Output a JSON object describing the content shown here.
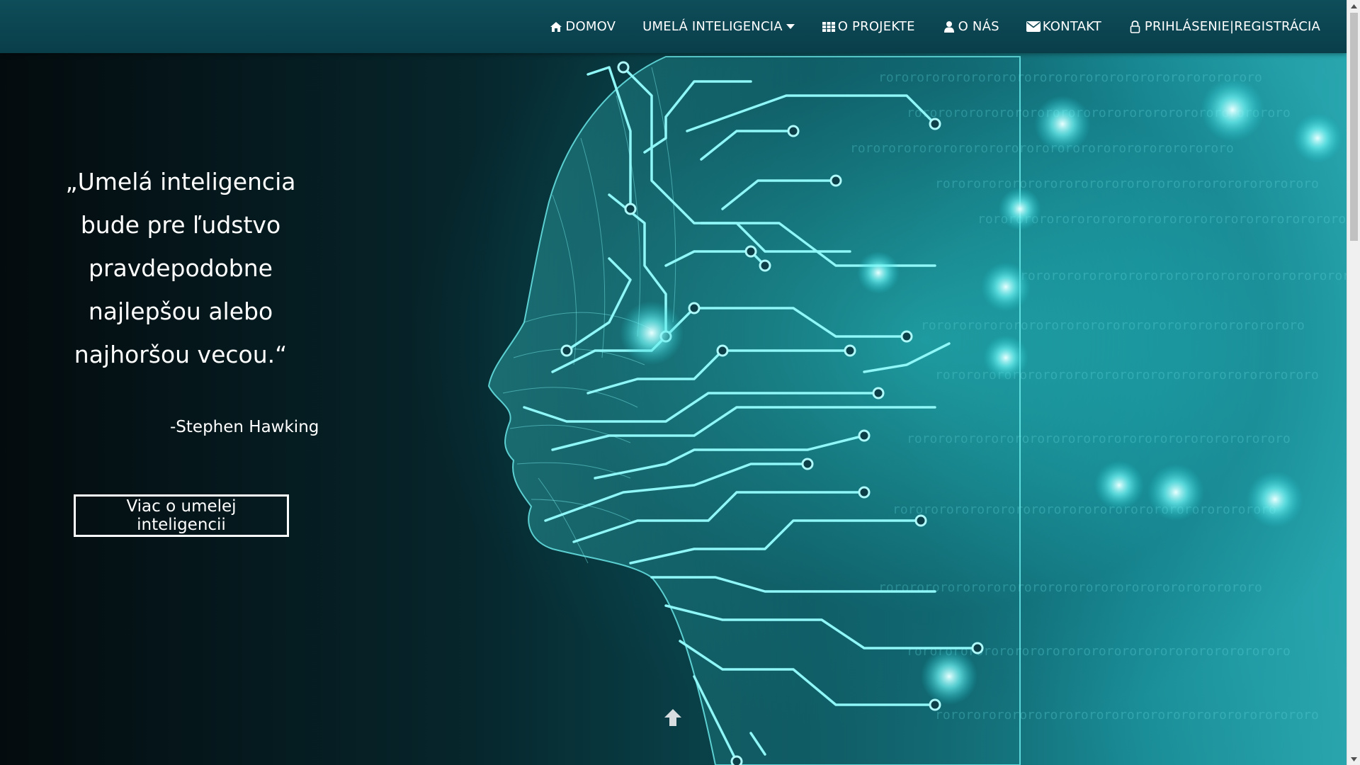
{
  "nav": {
    "items": [
      {
        "label": "DOMOV",
        "icon": "home-icon"
      },
      {
        "label": "UMELÁ INTELIGENCIA",
        "icon": "caret-down-icon"
      },
      {
        "label": "O PROJEKTE",
        "icon": "grid-icon"
      },
      {
        "label": "O NÁS",
        "icon": "user-icon"
      },
      {
        "label": "KONTAKT",
        "icon": "envelope-icon"
      },
      {
        "label": "PRIHLÁSENIE|REGISTRÁCIA",
        "icon": "lock-icon"
      }
    ]
  },
  "hero": {
    "quote_lines": [
      "„Umelá inteligencia",
      "bude pre ľudstvo",
      "pravdepodobne",
      "najlepšou alebo",
      "najhoršou vecou.“"
    ],
    "author": "-Stephen Hawking",
    "cta_label": "Viac o umelej inteligencii",
    "binary_text": "rororororororororororororororororororororororororo"
  },
  "colors": {
    "navbar": "#0c4652",
    "accent": "#3fe0e0",
    "text": "#ffffff"
  }
}
